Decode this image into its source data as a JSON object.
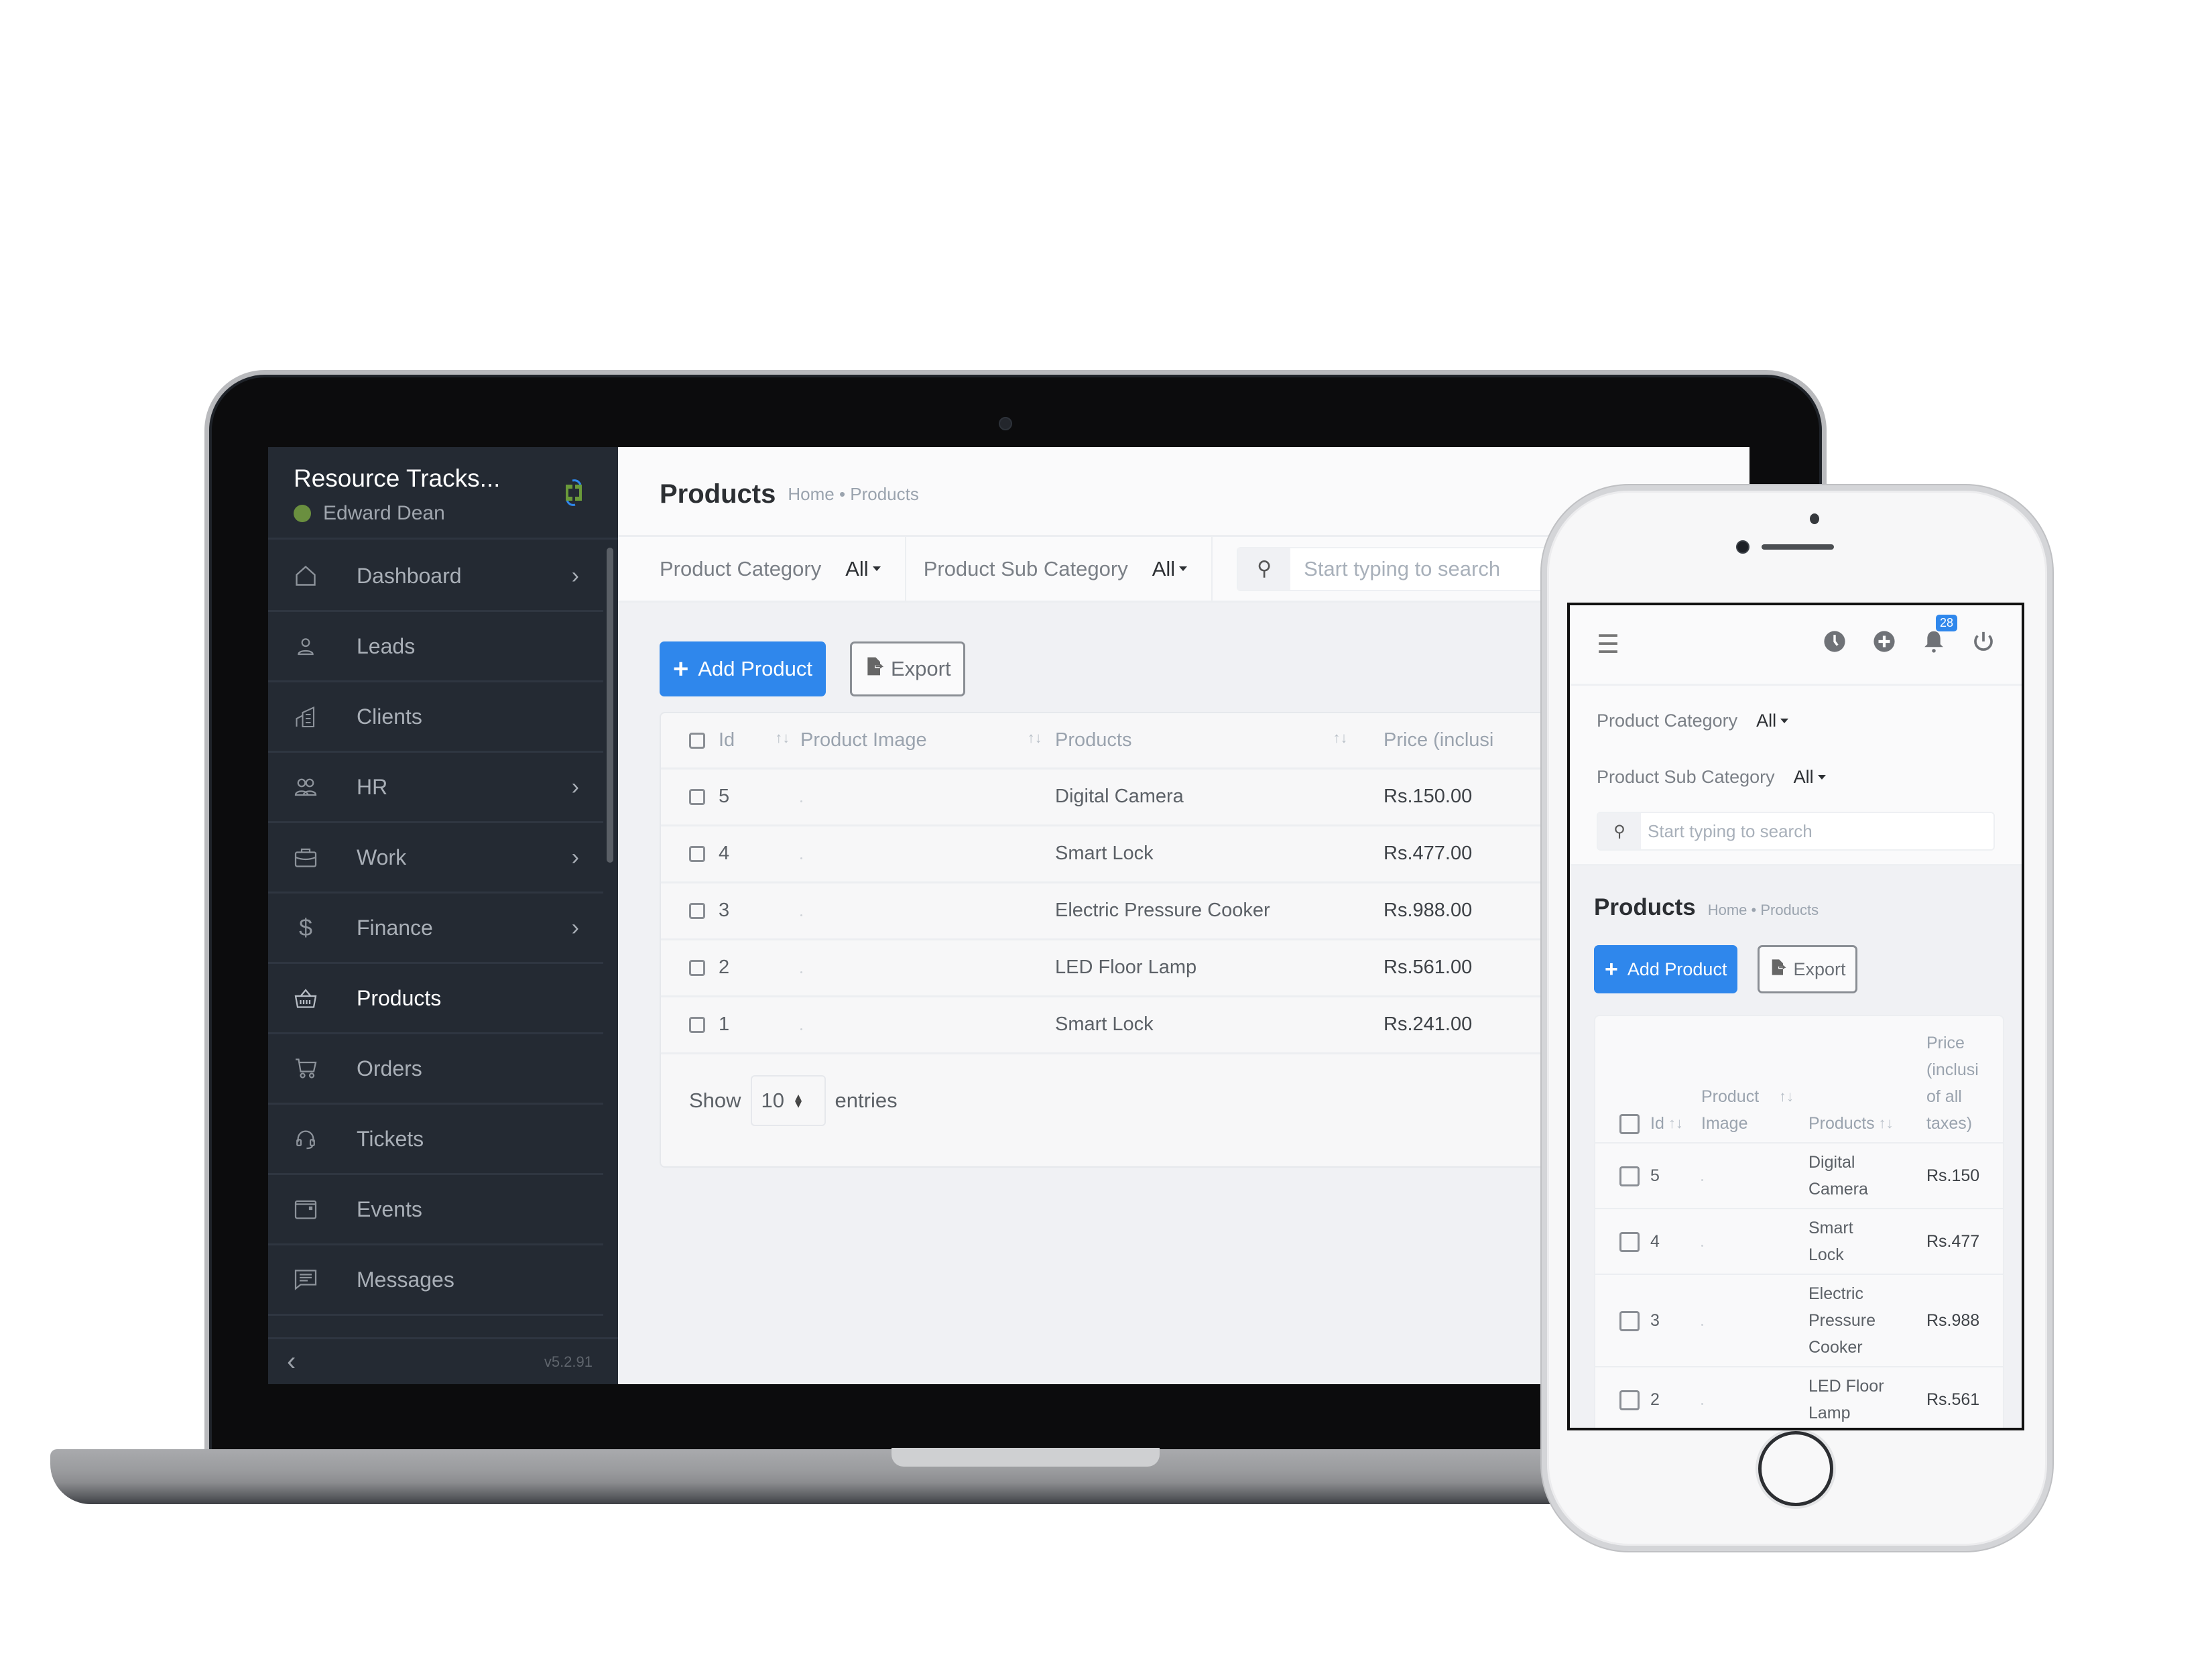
{
  "desktop": {
    "sidebar": {
      "app_title": "Resource Tracks...",
      "user_name": "Edward Dean",
      "user_status_color": "#6a8f3f",
      "items": [
        {
          "label": "Dashboard",
          "icon": "home-icon",
          "has_submenu": true
        },
        {
          "label": "Leads",
          "icon": "user-icon",
          "has_submenu": false
        },
        {
          "label": "Clients",
          "icon": "building-icon",
          "has_submenu": false
        },
        {
          "label": "HR",
          "icon": "users-icon",
          "has_submenu": true
        },
        {
          "label": "Work",
          "icon": "briefcase-icon",
          "has_submenu": true
        },
        {
          "label": "Finance",
          "icon": "dollar-icon",
          "has_submenu": true
        },
        {
          "label": "Products",
          "icon": "basket-icon",
          "has_submenu": false,
          "active": true
        },
        {
          "label": "Orders",
          "icon": "cart-icon",
          "has_submenu": false
        },
        {
          "label": "Tickets",
          "icon": "headset-icon",
          "has_submenu": false
        },
        {
          "label": "Events",
          "icon": "calendar-icon",
          "has_submenu": false
        },
        {
          "label": "Messages",
          "icon": "message-icon",
          "has_submenu": false
        }
      ],
      "collapse_icon": "chevron-left-icon",
      "version": "v5.2.91"
    },
    "header": {
      "title": "Products",
      "breadcrumb": "Home • Products"
    },
    "filters": {
      "category_label": "Product Category",
      "category_value": "All",
      "subcategory_label": "Product Sub Category",
      "subcategory_value": "All",
      "search_placeholder": "Start typing to search"
    },
    "actions": {
      "add_label": "Add Product",
      "export_label": "Export"
    },
    "table": {
      "columns": [
        "Id",
        "Product Image",
        "Products",
        "Price (inclusi"
      ],
      "rows": [
        {
          "id": "5",
          "product": "Digital Camera",
          "price": "Rs.150.00"
        },
        {
          "id": "4",
          "product": "Smart Lock",
          "price": "Rs.477.00"
        },
        {
          "id": "3",
          "product": "Electric Pressure Cooker",
          "price": "Rs.988.00"
        },
        {
          "id": "2",
          "product": "LED Floor Lamp",
          "price": "Rs.561.00"
        },
        {
          "id": "1",
          "product": "Smart Lock",
          "price": "Rs.241.00"
        }
      ],
      "show_label": "Show",
      "page_size": "10",
      "entries_label": "entries"
    }
  },
  "mobile": {
    "notification_count": "28",
    "filters": {
      "category_label": "Product Category",
      "category_value": "All",
      "subcategory_label": "Product Sub Category",
      "subcategory_value": "All",
      "search_placeholder": "Start typing to search"
    },
    "header": {
      "title": "Products",
      "breadcrumb": "Home • Products"
    },
    "actions": {
      "add_label": "Add Product",
      "export_label": "Export"
    },
    "table": {
      "columns": [
        "Id",
        "Product Image",
        "Products",
        "Price (inclusi of all taxes)"
      ],
      "rows": [
        {
          "id": "5",
          "product": "Digital Camera",
          "price": "Rs.150"
        },
        {
          "id": "4",
          "product": "Smart Lock",
          "price": "Rs.477"
        },
        {
          "id": "3",
          "product": "Electric Pressure Cooker",
          "price": "Rs.988"
        },
        {
          "id": "2",
          "product": "LED Floor Lamp",
          "price": "Rs.561"
        }
      ]
    }
  },
  "colors": {
    "accent": "#2f87ec",
    "sidebar_bg": "#242a33",
    "page_bg": "#f0f1f4"
  }
}
